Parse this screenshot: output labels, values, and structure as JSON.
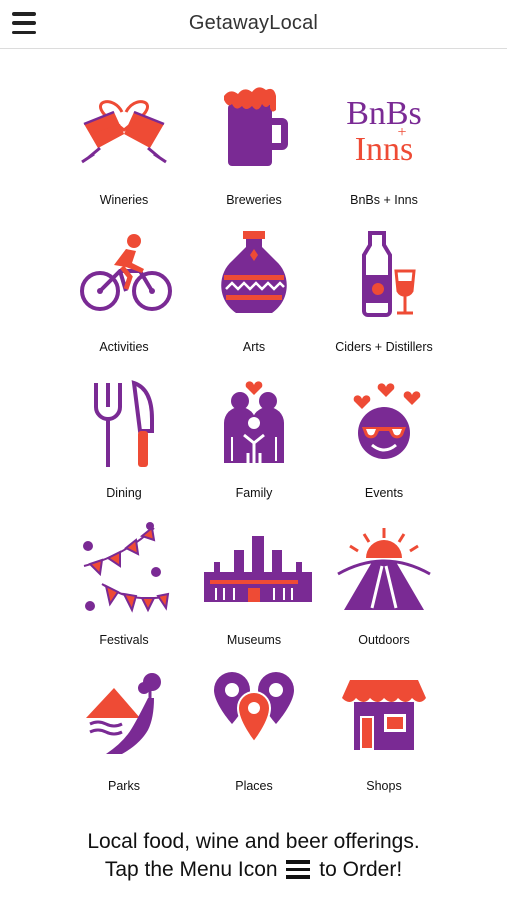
{
  "app": {
    "title": "GetawayLocal",
    "menu_icon": "hamburger-menu-icon"
  },
  "colors": {
    "purple": "#7a2a94",
    "red": "#ee4b35",
    "white": "#ffffff"
  },
  "categories": [
    {
      "label": "Wineries",
      "icon": "wine-glasses-heart-icon"
    },
    {
      "label": "Breweries",
      "icon": "beer-mug-icon"
    },
    {
      "label": "BnBs + Inns",
      "icon": "bnbs-inns-logo-icon",
      "logo_text": [
        "BnBs",
        "+",
        "Inns"
      ]
    },
    {
      "label": "Activities",
      "icon": "cyclist-icon"
    },
    {
      "label": "Arts",
      "icon": "vase-icon"
    },
    {
      "label": "Ciders + Distillers",
      "icon": "bottle-and-glass-icon"
    },
    {
      "label": "Dining",
      "icon": "fork-knife-icon"
    },
    {
      "label": "Family",
      "icon": "family-icon"
    },
    {
      "label": "Events",
      "icon": "heart-eyes-smiley-icon"
    },
    {
      "label": "Festivals",
      "icon": "bunting-flags-icon"
    },
    {
      "label": "Museums",
      "icon": "museum-building-icon"
    },
    {
      "label": "Outdoors",
      "icon": "sunrise-road-icon"
    },
    {
      "label": "Parks",
      "icon": "mountain-river-icon"
    },
    {
      "label": "Places",
      "icon": "map-pins-icon"
    },
    {
      "label": "Shops",
      "icon": "storefront-icon"
    }
  ],
  "footer": {
    "line1": "Local food, wine and beer offerings.",
    "line2_before": "Tap the Menu Icon",
    "line2_after": "to Order!"
  }
}
